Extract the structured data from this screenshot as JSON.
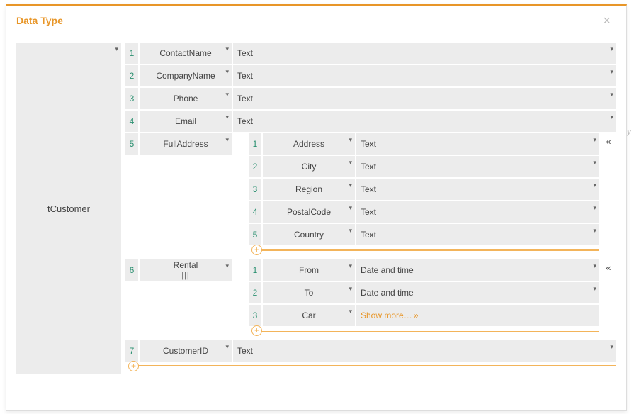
{
  "modal": {
    "title": "Data Type"
  },
  "root": {
    "name": "tCustomer",
    "fields": [
      {
        "idx": "1",
        "name": "ContactName",
        "type": "Text"
      },
      {
        "idx": "2",
        "name": "CompanyName",
        "type": "Text"
      },
      {
        "idx": "3",
        "name": "Phone",
        "type": "Text"
      },
      {
        "idx": "4",
        "name": "Email",
        "type": "Text"
      },
      {
        "idx": "5",
        "name": "FullAddress",
        "nested": "address"
      },
      {
        "idx": "6",
        "name": "Rental",
        "nested": "rental",
        "handle": true
      },
      {
        "idx": "7",
        "name": "CustomerID",
        "type": "Text"
      }
    ]
  },
  "address": {
    "fields": [
      {
        "idx": "1",
        "name": "Address",
        "type": "Text"
      },
      {
        "idx": "2",
        "name": "City",
        "type": "Text"
      },
      {
        "idx": "3",
        "name": "Region",
        "type": "Text"
      },
      {
        "idx": "4",
        "name": "PostalCode",
        "type": "Text"
      },
      {
        "idx": "5",
        "name": "Country",
        "type": "Text"
      }
    ]
  },
  "rental": {
    "fields": [
      {
        "idx": "1",
        "name": "From",
        "type": "Date and time"
      },
      {
        "idx": "2",
        "name": "To",
        "type": "Date and time"
      },
      {
        "idx": "3",
        "name": "Car",
        "type": "Show more…",
        "link": true
      }
    ]
  },
  "glyphs": {
    "caret": "▾",
    "collapse": "«",
    "plus": "+",
    "handle": "|||"
  }
}
